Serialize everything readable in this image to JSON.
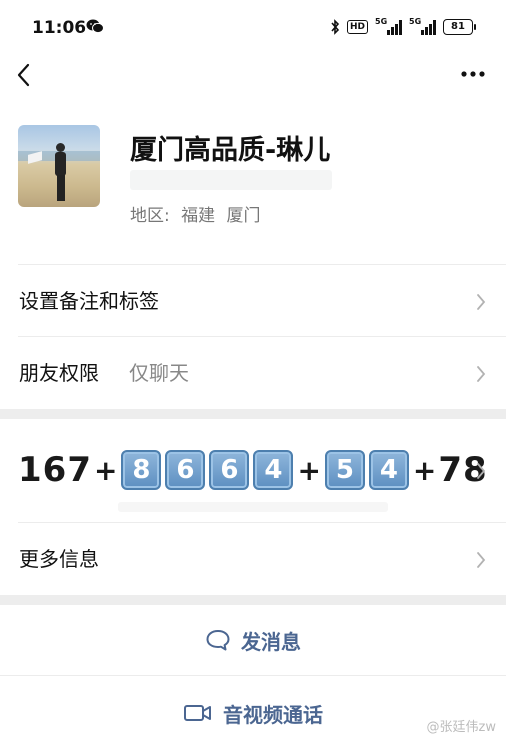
{
  "status_bar": {
    "time": "11:06",
    "hd": "HD",
    "network_1": "5G",
    "network_2": "5G",
    "battery": "81"
  },
  "profile": {
    "name": "厦门高品质-琳儿",
    "region_label": "地区:",
    "region_province": "福建",
    "region_city": "厦门"
  },
  "rows": {
    "remarks_label": "设置备注和标签",
    "permissions_label": "朋友权限",
    "permissions_value": "仅聊天",
    "more_info_label": "更多信息"
  },
  "phone": {
    "prefix": "167",
    "plus": "+",
    "digits_group_1": [
      "8",
      "6",
      "6",
      "4"
    ],
    "digits_group_2": [
      "5",
      "4"
    ],
    "suffix": "78"
  },
  "actions": {
    "message_label": "发消息",
    "call_label": "音视频通话"
  },
  "watermark": "@张廷伟zw",
  "colors": {
    "action_text": "#4b6691",
    "keycap": "#5d8fc1",
    "separator_band": "#ededed"
  },
  "icons": [
    "wechat-icon",
    "bluetooth-icon",
    "signal-icon",
    "battery-icon",
    "back-icon",
    "more-icon",
    "chevron-right-icon",
    "chat-bubble-icon",
    "video-call-icon"
  ]
}
